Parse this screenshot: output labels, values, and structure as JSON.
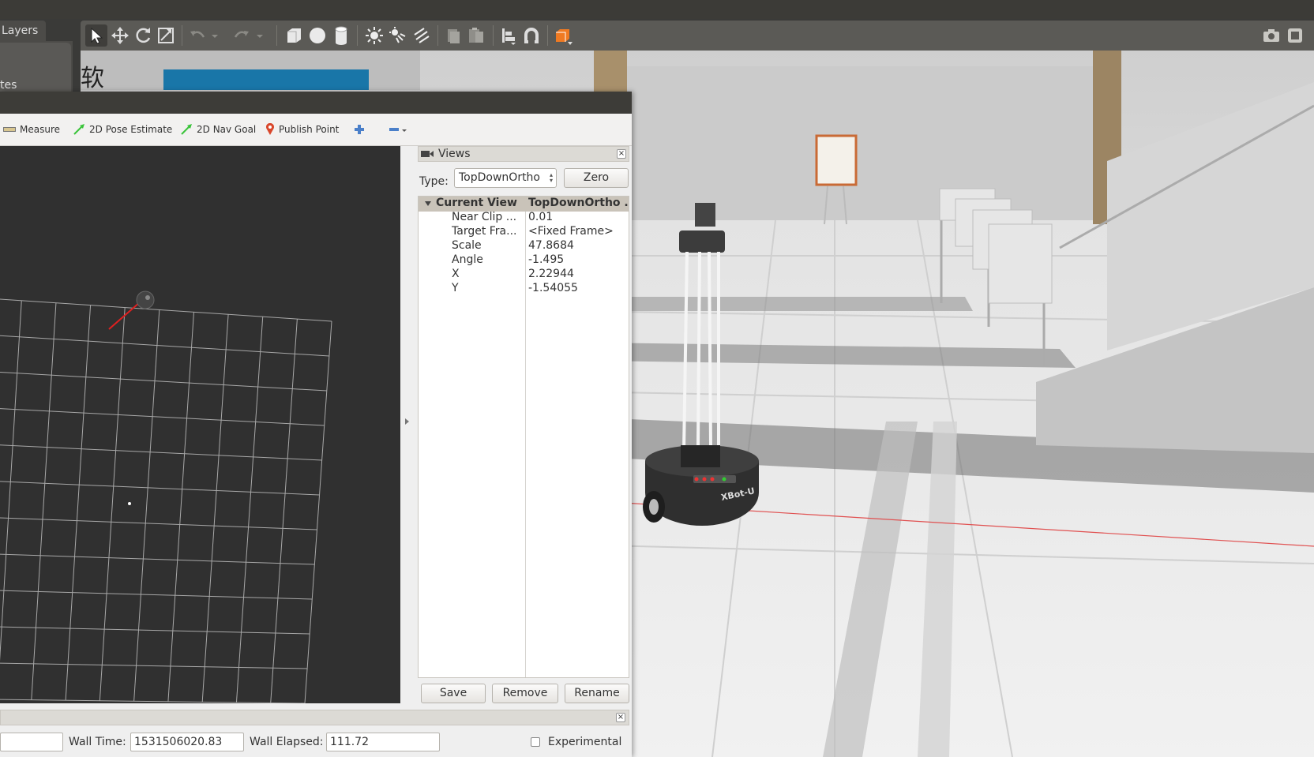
{
  "gazebo": {
    "layers_tab": "Layers",
    "left_panel_text": "tes",
    "toolbar_icons": [
      "select-arrow-icon",
      "translate-icon",
      "rotate-icon",
      "scale-icon",
      "undo-icon",
      "dropdown-icon",
      "redo-icon",
      "dropdown-icon",
      "box-icon",
      "sphere-icon",
      "cylinder-icon",
      "point-light-icon",
      "spot-light-icon",
      "directional-light-icon",
      "copy-icon",
      "paste-icon",
      "align-icon",
      "snap-icon",
      "view-angle-icon"
    ],
    "sign_text": "软",
    "robot_label": "XBot-U"
  },
  "rviz": {
    "tools": {
      "measure": "Measure",
      "pose_estimate": "2D Pose Estimate",
      "nav_goal": "2D Nav Goal",
      "publish_point": "Publish Point"
    },
    "views": {
      "title": "Views",
      "type_label": "Type:",
      "type_value": "TopDownOrtho",
      "zero_label": "Zero",
      "current_view_label": "Current View",
      "current_view_value": "TopDownOrtho ...",
      "properties": [
        {
          "key": "Near Clip ...",
          "value": "0.01"
        },
        {
          "key": "Target Fra...",
          "value": "<Fixed Frame>"
        },
        {
          "key": "Scale",
          "value": "47.8684"
        },
        {
          "key": "Angle",
          "value": "-1.495"
        },
        {
          "key": "X",
          "value": "2.22944"
        },
        {
          "key": "Y",
          "value": "-1.54055"
        }
      ],
      "save_label": "Save",
      "remove_label": "Remove",
      "rename_label": "Rename"
    },
    "time": {
      "wall_time_label": "Wall Time:",
      "wall_time_value": "1531506020.83",
      "wall_elapsed_label": "Wall Elapsed:",
      "wall_elapsed_value": "111.72",
      "experimental_label": "Experimental"
    }
  },
  "colors": {
    "gazebo_toolbar": "#5b5a56",
    "rviz_render_bg": "#303030",
    "tree_header": "#c9c3b9",
    "accent_orange": "#f07a22"
  }
}
